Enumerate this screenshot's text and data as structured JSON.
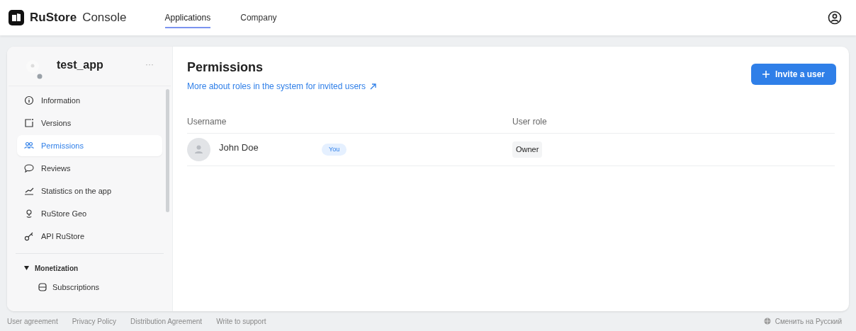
{
  "header": {
    "logo_text": "RuStore",
    "logo_suffix": "Console",
    "tabs": [
      {
        "label": "Applications",
        "selected": true
      },
      {
        "label": "Company",
        "selected": false
      }
    ]
  },
  "sidebar": {
    "app_name": "test_app",
    "more": "···",
    "items": [
      {
        "label": "Information",
        "selected": false
      },
      {
        "label": "Versions",
        "selected": false
      },
      {
        "label": "Permissions",
        "selected": true
      },
      {
        "label": "Reviews",
        "selected": false
      },
      {
        "label": "Statistics on the app",
        "selected": false
      },
      {
        "label": "RuStore Geo",
        "selected": false
      },
      {
        "label": "API RuStore",
        "selected": false
      }
    ],
    "section": {
      "label": "Monetization",
      "expanded": true,
      "children": [
        {
          "label": "Subscriptions",
          "selected": false
        }
      ]
    }
  },
  "main": {
    "title": "Permissions",
    "link": "More about roles in the system for invited users",
    "invite_button": "Invite a user",
    "table": {
      "columns": [
        "Username",
        "User role"
      ],
      "rows": [
        {
          "name": "John Doe",
          "badge": "You",
          "role": "Owner"
        }
      ]
    }
  },
  "footer": {
    "links": [
      "User agreement",
      "Privacy Policy",
      "Distribution Agreement",
      "Write to support"
    ],
    "language": "Сменить на Русский"
  }
}
